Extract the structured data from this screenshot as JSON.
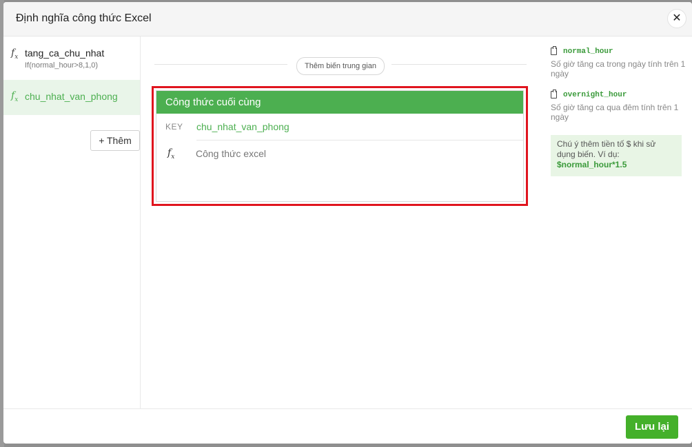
{
  "modal": {
    "title": "Định nghĩa công thức Excel",
    "close_icon": "close-icon",
    "close_symbol": "✕"
  },
  "formula_list": {
    "items": [
      {
        "name": "tang_ca_chu_nhat",
        "expression": "If(normal_hour>8,1,0)",
        "icon": "fx-icon",
        "selected": false
      },
      {
        "name": "chu_nhat_van_phong",
        "expression": "",
        "icon": "fx-icon",
        "selected": true
      }
    ],
    "add_button_label": "+ Thêm"
  },
  "editor": {
    "intermediate_button_label": "Thêm biến trung gian",
    "final_section_title": "Công thức cuối cùng",
    "key_label": "KEY",
    "key_value": "chu_nhat_van_phong",
    "formula_placeholder": "Công thức excel",
    "formula_value": "",
    "highlight_color": "#e0141e"
  },
  "variables": [
    {
      "name": "normal_hour",
      "description": "Số giờ tăng ca trong ngày tính trên 1 ngày",
      "icon": "clipboard-icon"
    },
    {
      "name": "overnight_hour",
      "description": "Số giờ tăng ca qua đêm tính trên 1 ngày",
      "icon": "clipboard-icon"
    }
  ],
  "note": {
    "text": "Chú ý thêm tiền tố $ khi sử dụng biến. Ví dụ:",
    "example": "$normal_hour*1.5"
  },
  "footer": {
    "save_label": "Lưu lại"
  },
  "colors": {
    "accent_green": "#4caf50",
    "save_green": "#44b02a",
    "note_bg": "#e8f5e5"
  }
}
